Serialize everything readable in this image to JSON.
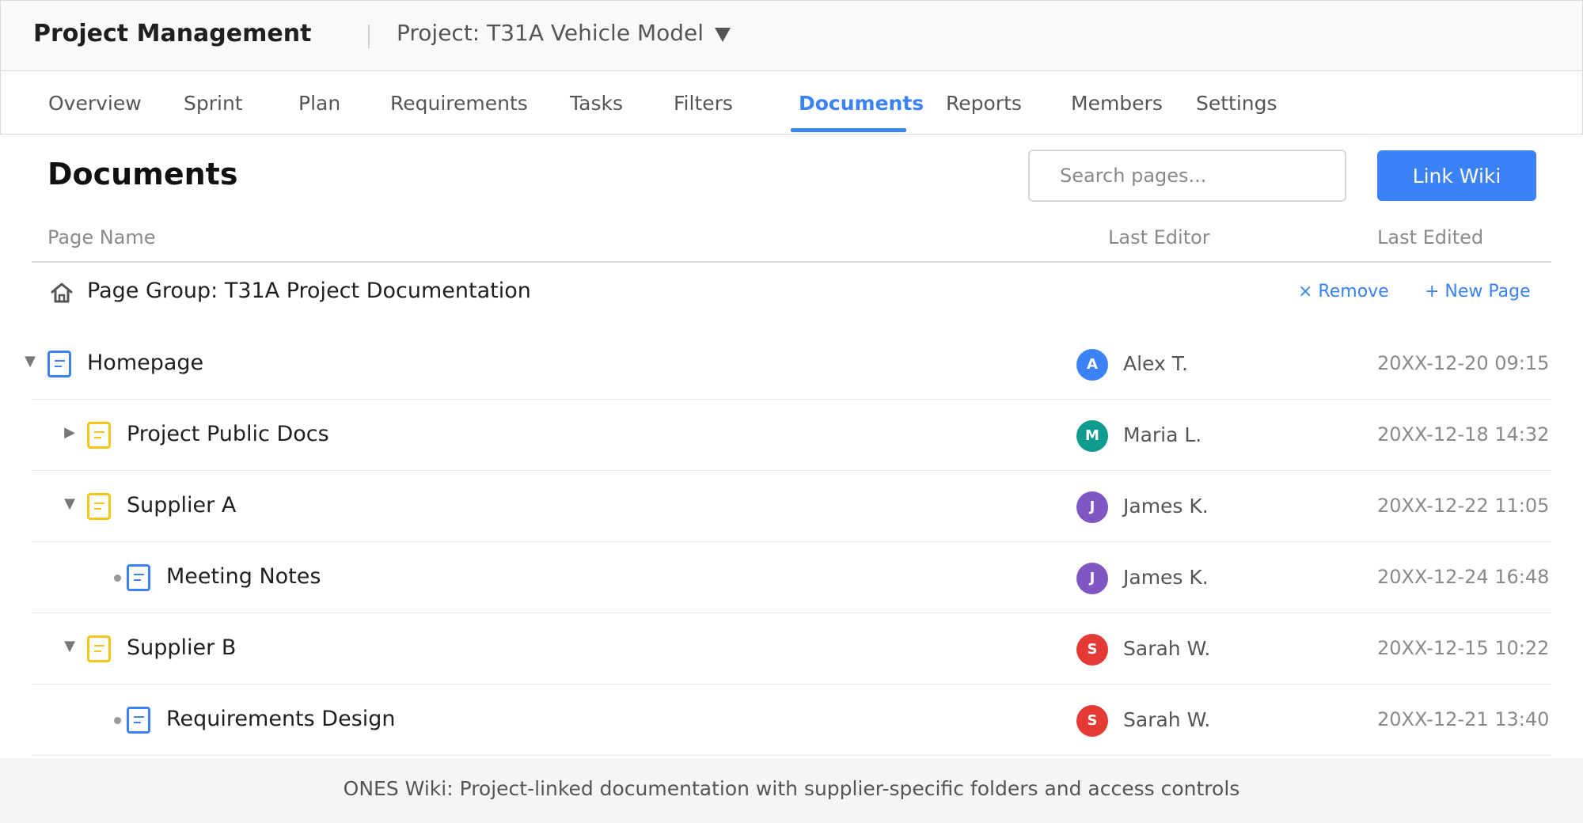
{
  "header": {
    "app_title": "Project Management",
    "project_label": "Project: T31A Vehicle Model"
  },
  "nav": {
    "tabs": [
      {
        "label": "Overview"
      },
      {
        "label": "Sprint"
      },
      {
        "label": "Plan"
      },
      {
        "label": "Requirements"
      },
      {
        "label": "Tasks"
      },
      {
        "label": "Filters"
      },
      {
        "label": "Documents",
        "active": true
      },
      {
        "label": "Reports"
      },
      {
        "label": "Members"
      },
      {
        "label": "Settings"
      }
    ]
  },
  "page": {
    "title": "Documents",
    "search_placeholder": "Search pages...",
    "link_wiki_label": "Link Wiki"
  },
  "table": {
    "columns": {
      "page_name": "Page Name",
      "last_editor": "Last Editor",
      "last_edited": "Last Edited"
    },
    "group": {
      "name": "Page Group: T31A Project Documentation",
      "remove_label": "× Remove",
      "new_page_label": "+ New Page"
    },
    "rows": [
      {
        "name": "Homepage",
        "toggle": "expanded",
        "icon": "document-icon",
        "icon_color": "#3b82f6",
        "editor_initial": "A",
        "editor_name": "Alex T.",
        "avatar_color": "#3b82f6",
        "edited": "20XX-12-20 09:15"
      },
      {
        "name": "Project Public Docs",
        "toggle": "collapsed",
        "icon": "folder-document-icon",
        "icon_color": "#f5c518",
        "editor_initial": "M",
        "editor_name": "Maria L.",
        "avatar_color": "#0f9b8e",
        "edited": "20XX-12-18 14:32"
      },
      {
        "name": "Supplier A",
        "toggle": "expanded",
        "icon": "folder-document-icon",
        "icon_color": "#f5c518",
        "editor_initial": "J",
        "editor_name": "James K.",
        "avatar_color": "#7e57c2",
        "edited": "20XX-12-22 11:05"
      },
      {
        "name": "Meeting Notes",
        "toggle": "leaf",
        "icon": "document-icon",
        "icon_color": "#3b82f6",
        "editor_initial": "J",
        "editor_name": "James K.",
        "avatar_color": "#7e57c2",
        "edited": "20XX-12-24 16:48"
      },
      {
        "name": "Supplier B",
        "toggle": "expanded",
        "icon": "folder-document-icon",
        "icon_color": "#f5c518",
        "editor_initial": "S",
        "editor_name": "Sarah W.",
        "avatar_color": "#e53935",
        "edited": "20XX-12-15 10:22"
      },
      {
        "name": "Requirements Design",
        "toggle": "leaf",
        "icon": "document-icon",
        "icon_color": "#3b82f6",
        "editor_initial": "S",
        "editor_name": "Sarah W.",
        "avatar_color": "#e53935",
        "edited": "20XX-12-21 13:40"
      }
    ]
  },
  "footer": {
    "text": "ONES Wiki: Project-linked documentation with supplier-specific folders and access controls"
  },
  "colors": {
    "accent": "#3b82f6",
    "folder": "#f5c518"
  }
}
